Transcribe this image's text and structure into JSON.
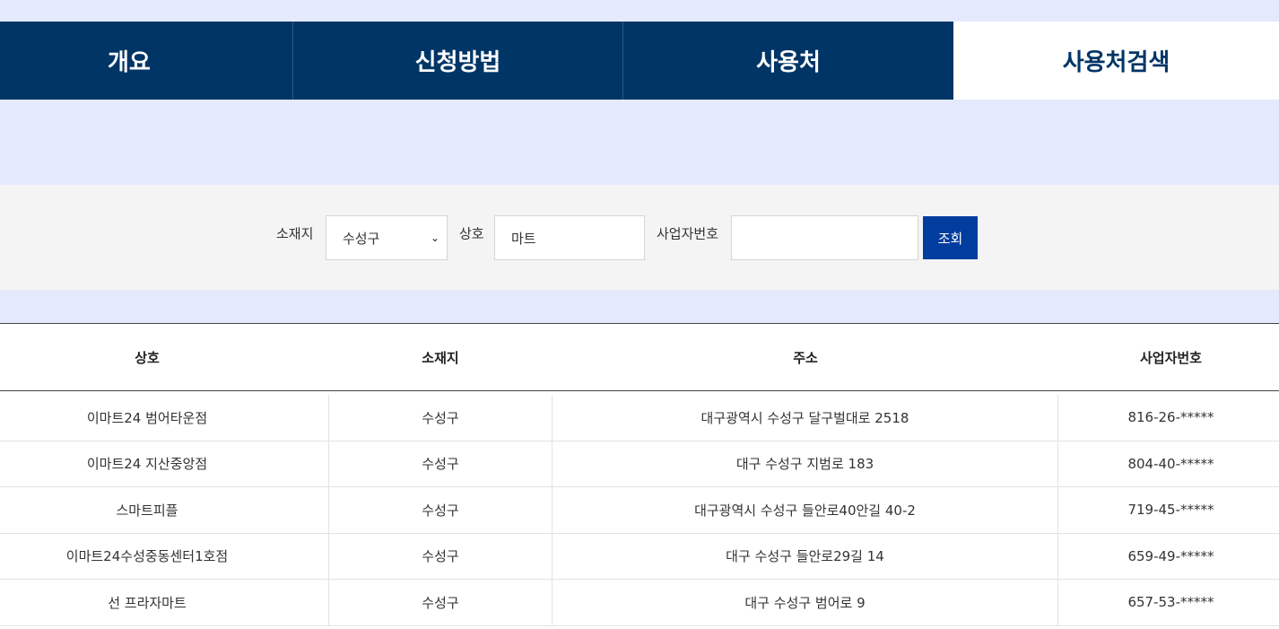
{
  "tabs": [
    {
      "label": "개요"
    },
    {
      "label": "신청방법"
    },
    {
      "label": "사용처"
    },
    {
      "label": "사용처검색"
    }
  ],
  "search": {
    "location_label": "소재지",
    "location_value": "수성구",
    "name_label": "상호",
    "name_value": "마트",
    "biz_label": "사업자번호",
    "biz_value": "",
    "submit_label": "조회"
  },
  "table": {
    "headers": [
      "상호",
      "소재지",
      "주소",
      "사업자번호"
    ],
    "rows": [
      [
        "이마트24 범어타운점",
        "수성구",
        "대구광역시 수성구 달구벌대로 2518",
        "816-26-*****"
      ],
      [
        "이마트24 지산중앙점",
        "수성구",
        "대구 수성구 지범로 183",
        "804-40-*****"
      ],
      [
        "스마트피플",
        "수성구",
        "대구광역시 수성구 들안로40안길 40-2",
        "719-45-*****"
      ],
      [
        "이마트24수성중동센터1호점",
        "수성구",
        "대구 수성구 들안로29길 14",
        "659-49-*****"
      ],
      [
        "선 프라자마트",
        "수성구",
        "대구 수성구 범어로 9",
        "657-53-*****"
      ]
    ]
  }
}
